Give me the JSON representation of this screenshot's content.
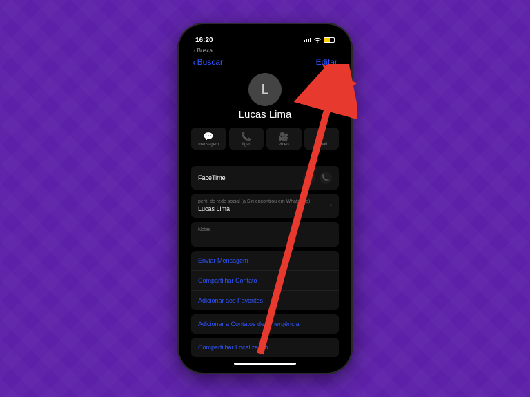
{
  "statusbar": {
    "time": "16:20",
    "back_hint": "Busca"
  },
  "nav": {
    "back": "Buscar",
    "edit": "Editar"
  },
  "contact": {
    "initial": "L",
    "name": "Lucas Lima"
  },
  "actions": {
    "message": "mensagem",
    "call": "ligar",
    "video": "vídeo",
    "mail": "e-mail"
  },
  "facetime": {
    "label": "FaceTime"
  },
  "social": {
    "caption": "perfil de rede social (a Siri encontrou em WhatsApp)",
    "value": "Lucas Lima"
  },
  "notes": {
    "label": "Notas"
  },
  "links": {
    "send_message": "Enviar Mensagem",
    "share_contact": "Compartilhar Contato",
    "add_favorite": "Adicionar aos Favoritos",
    "add_emergency": "Adicionar a Contatos de Emergência",
    "share_location": "Compartilhar Localização"
  }
}
